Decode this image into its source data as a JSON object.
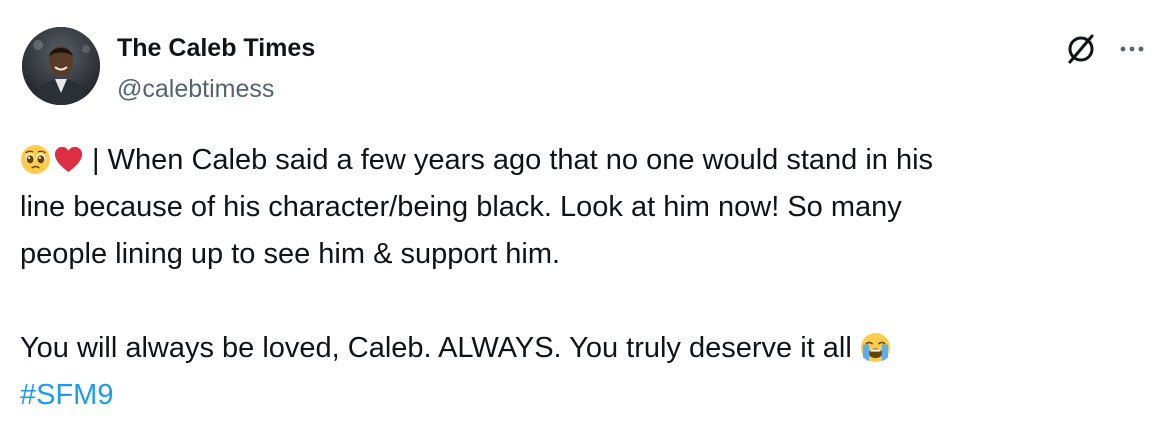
{
  "author": {
    "name": "The Caleb Times",
    "handle": "@calebtimess"
  },
  "icons": {
    "grok": "grok-icon",
    "more": "more-horizontal-icon",
    "emoji_1": "pleading-face-emoji",
    "emoji_2": "red-heart-emoji",
    "emoji_3": "loudly-crying-face-emoji"
  },
  "tweet": {
    "line1": " | When Caleb said a few years ago that no one would stand in his",
    "line2": "line because of his character/being black. Look at him now! So many",
    "line3": "people lining up to see him & support him.",
    "line4": "You will always be loved, Caleb. ALWAYS. You truly deserve it all ",
    "hashtag": "#SFM9"
  },
  "colors": {
    "text": "#0f1419",
    "secondary": "#536471",
    "link": "#1d9bf0"
  }
}
